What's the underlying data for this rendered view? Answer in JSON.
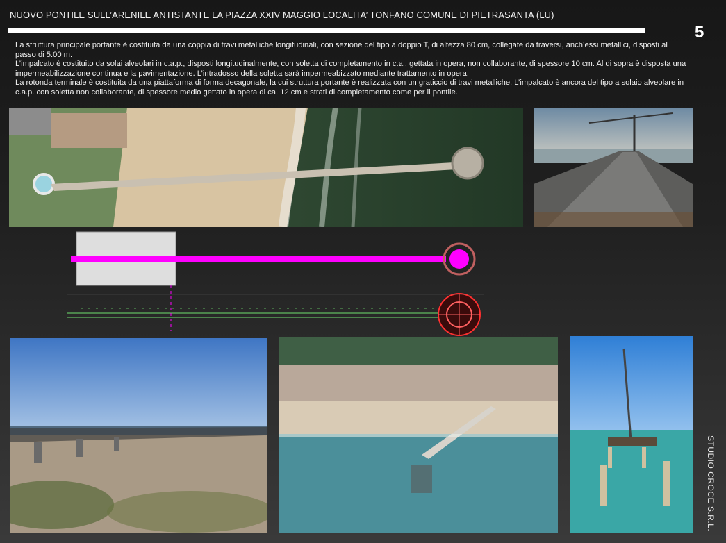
{
  "header": {
    "title": "NUOVO PONTILE SULL’ARENILE ANTISTANTE LA PIAZZA XXIV MAGGIO  LOCALITA’  TONFANO COMUNE DI PIETRASANTA (LU)",
    "page_number": "5"
  },
  "description": {
    "p1": "La struttura principale portante è costituita da una coppia di travi metalliche longitudinali, con sezione del tipo a doppio T, di altezza 80 cm, collegate da traversi, anch’essi metallici, disposti al passo di 5.00 m.",
    "p2": "L’impalcato è costituito da solai alveolari in c.a.p., disposti longitudinalmente, con soletta di completamento in c.a., gettata in opera, non collaborante, di spessore 10 cm. Al di sopra è disposta una impermeabilizzazione continua e la pavimentazione. L’intradosso della soletta sarà impermeabizzato mediante trattamento in opera.",
    "p3": "La rotonda terminale è costituita da una piattaforma di forma decagonale, la cui struttura portante è realizzata con un graticcio di travi metalliche. L’impalcato è ancora del tipo a solaio alveolare in c.a.p. con soletta non collaborante, di spessore medio gettato in opera di ca. 12 cm e strati di completamento come per il pontile."
  },
  "side_label": "STUDIO CROCE S.R.L.",
  "colors": {
    "background": "#1c1c1c",
    "drawing_magenta": "#ff00ff",
    "drawing_green": "#6fe06f",
    "sea": "#2f4a33",
    "sand": "#d6c3a1"
  }
}
